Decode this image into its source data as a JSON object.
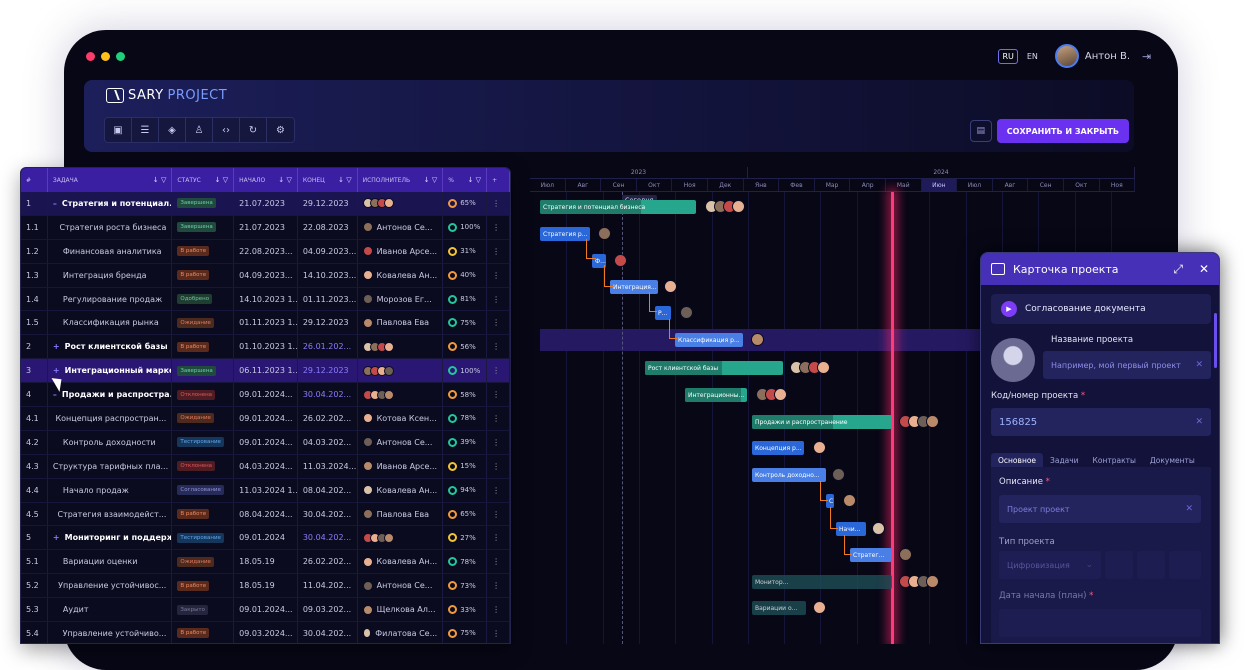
{
  "app": {
    "brand_a": "SARY",
    "brand_b": "PROJECT"
  },
  "topbar": {
    "lang_ru": "RU",
    "lang_en": "EN",
    "user": "Антон В."
  },
  "toolbar": {
    "save_close": "СОХРАНИТЬ И ЗАКРЫТЬ",
    "tools": [
      "user-card-icon",
      "document-icon",
      "layers-icon",
      "person-icon",
      "code-icon",
      "refresh-icon",
      "gear-icon"
    ]
  },
  "table": {
    "headers": [
      "#",
      "ЗАДАЧА",
      "СТАТУС",
      "НАЧАЛО",
      "КОНЕЦ",
      "ИСПОЛНИТЕЛЬ",
      "%",
      "+"
    ],
    "rows": [
      {
        "n": "1",
        "name": "Стратегия и потенциал...",
        "status": "Завершена",
        "cls": "b-done",
        "start": "21.07.2023",
        "end": "29.12.2023",
        "who": "",
        "pct": "65%",
        "ring": "",
        "group": true,
        "exp": "–"
      },
      {
        "n": "1.1",
        "name": "Стратегия роста бизнеса",
        "status": "Завершена",
        "cls": "b-done",
        "start": "21.07.2023",
        "end": "22.08.2023",
        "who": "Антонов Се...",
        "pct": "100%",
        "ring": "g"
      },
      {
        "n": "1.2",
        "name": "Финансовая аналитика",
        "status": "В работе",
        "cls": "b-work",
        "start": "22.08.2023...",
        "end": "04.09.2023...",
        "who": "Иванов Арсе...",
        "pct": "31%",
        "ring": "y"
      },
      {
        "n": "1.3",
        "name": "Интеграция бренда",
        "status": "В работе",
        "cls": "b-work",
        "start": "04.09.2023...",
        "end": "14.10.2023...",
        "who": "Ковалева Ан...",
        "pct": "40%",
        "ring": ""
      },
      {
        "n": "1.4",
        "name": "Регулирование продаж",
        "status": "Одобрено",
        "cls": "b-appr",
        "start": "14.10.2023 1...",
        "end": "01.11.2023...",
        "who": "Морозов Ег...",
        "pct": "81%",
        "ring": "g"
      },
      {
        "n": "1.5",
        "name": "Классификация рынка",
        "status": "Ожидание",
        "cls": "b-wait",
        "start": "01.11.2023 1...",
        "end": "29.12.2023",
        "who": "Павлова Ева",
        "pct": "75%",
        "ring": "g"
      },
      {
        "n": "2",
        "name": "Рост клиентской базы",
        "status": "В работе",
        "cls": "b-work",
        "start": "01.10.2023 1...",
        "end": "26.01.202...",
        "who": "",
        "pct": "56%",
        "ring": "",
        "group": true,
        "exp": "+"
      },
      {
        "n": "3",
        "name": "Интеграционный марке...",
        "status": "Завершена",
        "cls": "b-done",
        "start": "06.11.2023 1...",
        "end": "29.12.2023",
        "who": "",
        "pct": "100%",
        "ring": "g",
        "group": true,
        "sel": true,
        "exp": "+"
      },
      {
        "n": "4",
        "name": "Продажи и распростра...",
        "status": "Отклонена",
        "cls": "b-rej",
        "start": "09.01.2024...",
        "end": "30.04.202...",
        "who": "",
        "pct": "58%",
        "ring": "",
        "group": true,
        "exp": "–"
      },
      {
        "n": "4.1",
        "name": "Концепция распростран...",
        "status": "Ожидание",
        "cls": "b-wait",
        "start": "09.01.2024...",
        "end": "26.02.202...",
        "who": "Котова Ксен...",
        "pct": "78%",
        "ring": "g"
      },
      {
        "n": "4.2",
        "name": "Контроль доходности",
        "status": "Тестирование",
        "cls": "b-test",
        "start": "09.01.2024...",
        "end": "04.03.202...",
        "who": "Антонов Се...",
        "pct": "39%",
        "ring": "g"
      },
      {
        "n": "4.3",
        "name": "Структура тарифных пла...",
        "status": "Отклонена",
        "cls": "b-rej",
        "start": "04.03.2024...",
        "end": "11.03.2024...",
        "who": "Иванов Арсе...",
        "pct": "15%",
        "ring": "y"
      },
      {
        "n": "4.4",
        "name": "Начало продаж",
        "status": "Согласование",
        "cls": "b-agr",
        "start": "11.03.2024 1...",
        "end": "08.04.202...",
        "who": "Ковалева Ан...",
        "pct": "94%",
        "ring": "g"
      },
      {
        "n": "4.5",
        "name": "Стратегия взаимодейст...",
        "status": "В работе",
        "cls": "b-work",
        "start": "08.04.2024...",
        "end": "30.04.202...",
        "who": "Павлова Ева",
        "pct": "65%",
        "ring": ""
      },
      {
        "n": "5",
        "name": "Мониторинг и поддерж...",
        "status": "Тестирование",
        "cls": "b-test",
        "start": "09.01.2024",
        "end": "30.04.202...",
        "who": "",
        "pct": "27%",
        "ring": "y",
        "group": true,
        "exp": "+"
      },
      {
        "n": "5.1",
        "name": "Вариации оценки",
        "status": "Ожидание",
        "cls": "b-wait",
        "start": "18.05.19",
        "end": "26.02.202...",
        "who": "Ковалева Ан...",
        "pct": "78%",
        "ring": "g"
      },
      {
        "n": "5.2",
        "name": "Управление устойчивос...",
        "status": "В работе",
        "cls": "b-work",
        "start": "18.05.19",
        "end": "11.04.202...",
        "who": "Антонов Се...",
        "pct": "73%",
        "ring": ""
      },
      {
        "n": "5.3",
        "name": "Аудит",
        "status": "Закрыто",
        "cls": "b-clos",
        "start": "09.01.2024...",
        "end": "09.03.202...",
        "who": "Щелкова Ал...",
        "pct": "33%",
        "ring": ""
      },
      {
        "n": "5.4",
        "name": "Управление устойчиво...",
        "status": "В работе",
        "cls": "b-work",
        "start": "09.03.2024...",
        "end": "30.04.202...",
        "who": "Филатова Се...",
        "pct": "75%",
        "ring": ""
      }
    ]
  },
  "gantt": {
    "years": [
      "2023",
      "2024"
    ],
    "months": [
      "Июл",
      "Авг",
      "Сен",
      "Окт",
      "Ноя",
      "Дек",
      "Янв",
      "Фев",
      "Мар",
      "Апр",
      "Май",
      "Июн",
      "Июл",
      "Авг",
      "Сен",
      "Окт",
      "Ноя"
    ],
    "today": "Сегодня",
    "bars": [
      {
        "label": "Стратегия и потенциал бизнеса"
      },
      {
        "label": "Стратегия р..."
      },
      {
        "label": "Ф..."
      },
      {
        "label": "Интеграция..."
      },
      {
        "label": "Р..."
      },
      {
        "label": "Классификация р..."
      },
      {
        "label": "Рост клиентской базы"
      },
      {
        "label": "Интеграционны..."
      },
      {
        "label": "Продажи и распространение"
      },
      {
        "label": "Концепция р..."
      },
      {
        "label": "Контроль доходно..."
      },
      {
        "label": "С"
      },
      {
        "label": "Начи..."
      },
      {
        "label": "Стратег..."
      },
      {
        "label": "Монитор..."
      },
      {
        "label": "Вариации о..."
      }
    ]
  },
  "card": {
    "title": "Карточка проекта",
    "doc": "Согласование документа",
    "name_label": "Название проекта",
    "name_placeholder": "Например, мой первый проект",
    "code_label": "Код/номер проекта",
    "code_value": "156825",
    "tabs": [
      "Основное",
      "Задачи",
      "Контракты",
      "Документы"
    ],
    "desc_label": "Описание",
    "desc_value": "Проект проект",
    "type_label": "Тип проекта",
    "type_value": "Цифровизация",
    "date_label": "Дата начала (план)"
  }
}
